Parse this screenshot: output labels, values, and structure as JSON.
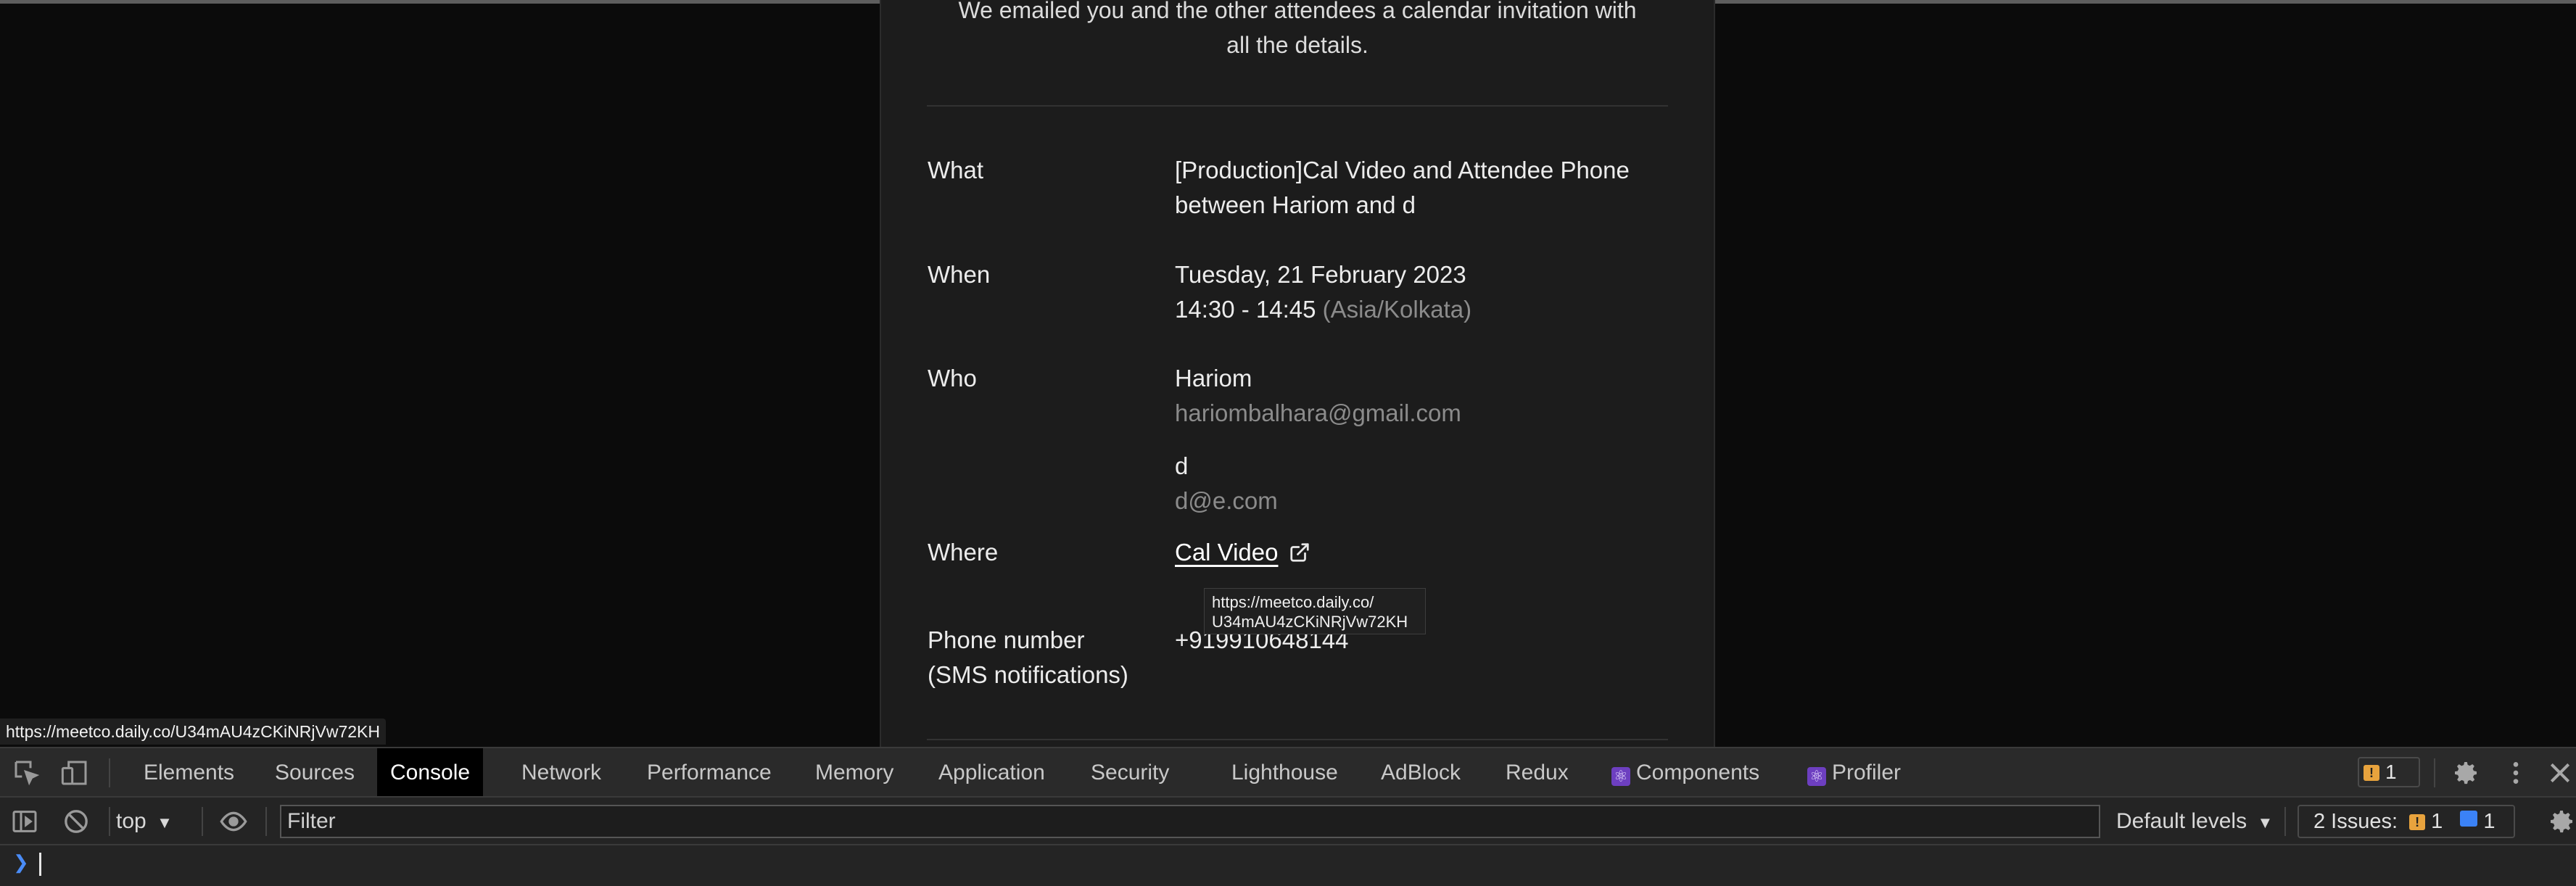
{
  "page": {
    "intro_line1": "We emailed you and the other attendees a calendar invitation with",
    "intro_line2": "all the details.",
    "rows": {
      "what": {
        "label": "What",
        "value_line1": "[Production]Cal Video and Attendee Phone",
        "value_line2": "between Hariom and d"
      },
      "when": {
        "label": "When",
        "date": "Tuesday, 21 February 2023",
        "time": "14:30 - 14:45",
        "timezone": "(Asia/Kolkata)"
      },
      "who": {
        "label": "Who",
        "attendees": [
          {
            "name": "Hariom",
            "email": "hariombalhara@gmail.com"
          },
          {
            "name": "d",
            "email": "d@e.com"
          }
        ]
      },
      "where": {
        "label": "Where",
        "link_text": "Cal Video",
        "link_icon": "external-link-icon"
      },
      "phone": {
        "label_line1": "Phone number",
        "label_line2": "(SMS notifications)",
        "value": "+919910648144"
      }
    },
    "tooltip": {
      "line1": "https://meetco.daily.co/",
      "line2": "U34mAU4zCKiNRjVw72KH"
    }
  },
  "status_bar": {
    "url": "https://meetco.daily.co/U34mAU4zCKiNRjVw72KH"
  },
  "devtools": {
    "tabs": [
      "Elements",
      "Sources",
      "Console",
      "Network",
      "Performance",
      "Memory",
      "Application",
      "Security",
      "Lighthouse",
      "AdBlock",
      "Redux",
      "Components",
      "Profiler"
    ],
    "active_tab": "Console",
    "warning_count": "1",
    "toolbar": {
      "context": "top",
      "filter_placeholder": "Filter",
      "levels": "Default levels",
      "issues_label": "2 Issues:",
      "issues_warn": "1",
      "issues_info": "1"
    },
    "colors": {
      "accent_warn": "#e8a33d",
      "accent_info": "#3b82f6",
      "active_tab_bg": "#000000"
    }
  }
}
